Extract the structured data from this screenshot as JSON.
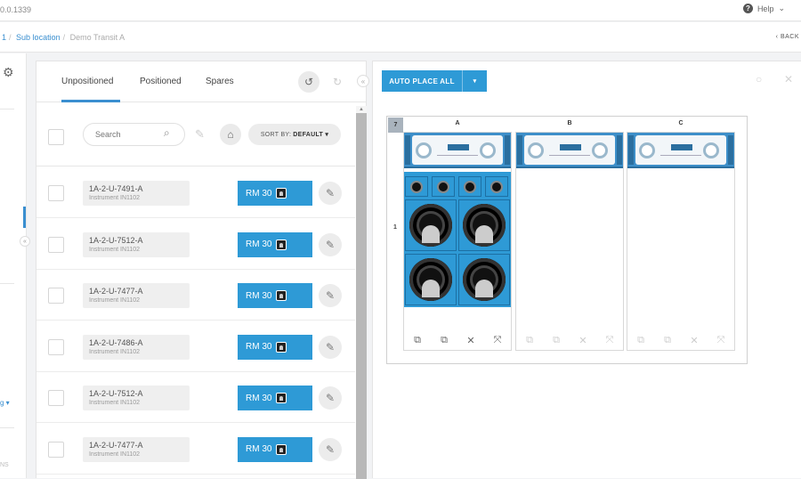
{
  "topbar": {
    "version": "0.0.1339",
    "help_label": "Help",
    "help_icon_glyph": "?",
    "help_caret": "⌄"
  },
  "breadcrumb": {
    "items": [
      "1",
      "Sub location"
    ],
    "current": "Demo Transit A",
    "back_label": "BACK",
    "back_icon": "‹"
  },
  "sidebar": {
    "gear_icon": "⚙",
    "collapse_icon": "«",
    "dropdown_label": "g ▾",
    "bottom_label": "NS"
  },
  "tabs": [
    {
      "label": "Unpositioned"
    },
    {
      "label": "Positioned"
    },
    {
      "label": "Spares"
    }
  ],
  "toolbar": {
    "undo_icon": "↺",
    "redo_icon": "↻",
    "collapse_icon": "«"
  },
  "filter": {
    "search_placeholder": "Search",
    "search_icon": "⌕",
    "pencil_icon": "✎",
    "tag_icon": "⌂",
    "sort_prefix": "SORT BY:",
    "sort_value": "DEFAULT ▾"
  },
  "items": [
    {
      "code": "1A-2-U-7491-A",
      "instrument": "Instrument IN1102",
      "rm_label": "RM 30"
    },
    {
      "code": "1A-2-U-7512-A",
      "instrument": "Instrument IN1102",
      "rm_label": "RM 30"
    },
    {
      "code": "1A-2-U-7477-A",
      "instrument": "Instrument IN1102",
      "rm_label": "RM 30"
    },
    {
      "code": "1A-2-U-7486-A",
      "instrument": "Instrument IN1102",
      "rm_label": "RM 30"
    },
    {
      "code": "1A-2-U-7512-A",
      "instrument": "Instrument IN1102",
      "rm_label": "RM 30"
    },
    {
      "code": "1A-2-U-7477-A",
      "instrument": "Instrument IN1102",
      "rm_label": "RM 30"
    }
  ],
  "edit_icon": "✎",
  "layout": {
    "auto_place_label": "AUTO PLACE ALL",
    "auto_place_caret": "▾",
    "zoom_icon": "○",
    "close_icon": "✕",
    "row_header": "7",
    "row_label": "1",
    "columns": [
      "A",
      "B",
      "C"
    ],
    "action_icons": [
      "⧉",
      "⧉",
      "✕",
      "⤧"
    ]
  },
  "colors": {
    "accent": "#2e9ad6",
    "link": "#3a8fd0"
  }
}
